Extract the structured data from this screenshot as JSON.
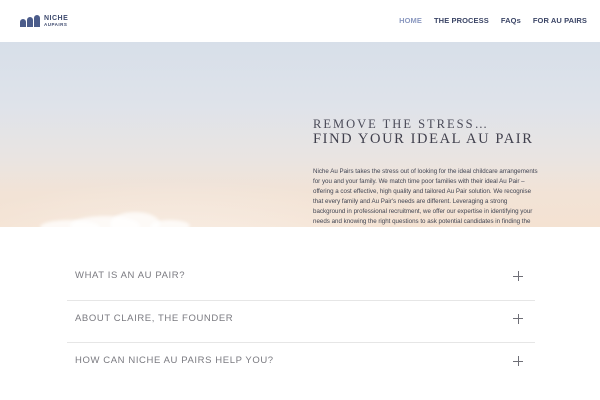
{
  "brand": {
    "line1": "NICHE",
    "line2": "AUPAIRS",
    "icon": "niche-aupairs-logo-icon",
    "color": "#3e4a6e"
  },
  "nav": {
    "items": [
      {
        "label": "HOME",
        "active": true
      },
      {
        "label": "THE PROCESS",
        "active": false
      },
      {
        "label": "FAQs",
        "active": false
      },
      {
        "label": "FOR AU PAIRS",
        "active": false
      }
    ],
    "active_color": "#8b99c0",
    "color": "#3b4566"
  },
  "hero": {
    "title_line1": "REMOVE THE STRESS…",
    "title_line2": "FIND YOUR IDEAL AU PAIR",
    "body": "Niche Au Pairs takes the stress out of looking for the ideal childcare arrangements for you and your family. We match time poor families with their ideal Au Pair – offering a cost effective, high quality and tailored Au Pair solution. We recognise that every family and Au Pair's needs are different. Leveraging a strong background in professional recruitment, we offer our expertise in identifying your needs and knowing the right questions to ask potential candidates in finding the right match for your family."
  },
  "accordion": {
    "items": [
      {
        "title": "WHAT IS AN AU PAIR?",
        "icon": "plus-icon"
      },
      {
        "title": "ABOUT CLAIRE, THE FOUNDER",
        "icon": "plus-icon"
      },
      {
        "title": "HOW CAN NICHE AU PAIRS HELP YOU?",
        "icon": "plus-icon"
      }
    ]
  }
}
